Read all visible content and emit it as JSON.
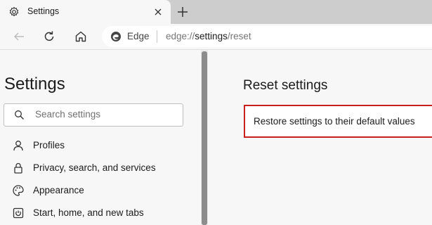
{
  "tab": {
    "title": "Settings",
    "icon": "gear-icon"
  },
  "toolbar": {
    "back_icon": "back-arrow-icon",
    "refresh_icon": "refresh-icon",
    "home_icon": "home-icon"
  },
  "address": {
    "site_label": "Edge",
    "url_prefix": "edge://",
    "url_host": "settings",
    "url_path": "/reset"
  },
  "sidebar": {
    "title": "Settings",
    "search_placeholder": "Search settings",
    "items": [
      {
        "label": "Profiles",
        "icon": "profile-icon"
      },
      {
        "label": "Privacy, search, and services",
        "icon": "lock-icon"
      },
      {
        "label": "Appearance",
        "icon": "palette-icon"
      },
      {
        "label": "Start, home, and new tabs",
        "icon": "power-icon"
      }
    ]
  },
  "main": {
    "title": "Reset settings",
    "reset_option": "Restore settings to their default values"
  },
  "colors": {
    "highlight": "#c8201e",
    "accent_edge": "#0f7bb7"
  }
}
